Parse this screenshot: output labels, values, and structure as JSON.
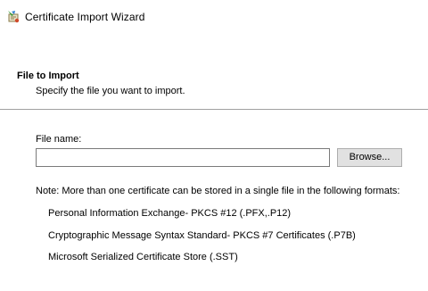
{
  "window": {
    "title": "Certificate Import Wizard",
    "icon": "certificate-wizard-icon"
  },
  "header": {
    "title": "File to Import",
    "subtitle": "Specify the file you want to import."
  },
  "form": {
    "file_label": "File name:",
    "file_value": "",
    "browse_label": "Browse..."
  },
  "note": "Note:  More than one certificate can be stored in a single file in the following formats:",
  "formats": [
    "Personal Information Exchange- PKCS #12 (.PFX,.P12)",
    "Cryptographic Message Syntax Standard- PKCS #7 Certificates (.P7B)",
    "Microsoft Serialized Certificate Store (.SST)"
  ],
  "colors": {
    "divider": "#a0a0a0",
    "button_face": "#e1e1e1",
    "input_border": "#7a7a7a"
  }
}
